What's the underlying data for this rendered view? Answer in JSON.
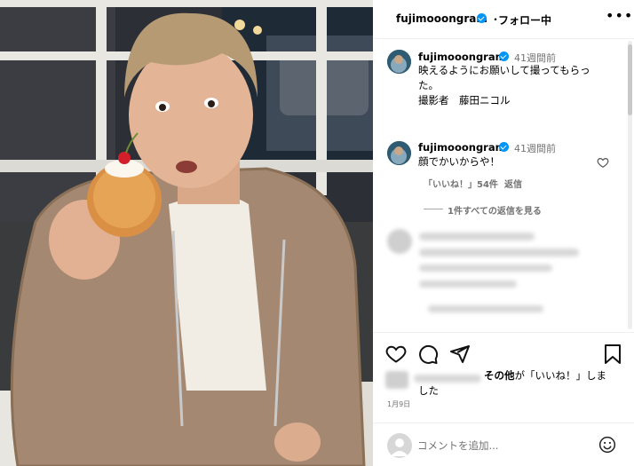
{
  "header": {
    "username": "fujimooongram",
    "dot": "・",
    "follow_status": "フォロー中",
    "more": "•••"
  },
  "comments": [
    {
      "username": "fujimooongram",
      "time": "41週間前",
      "text_line1": "映えるようにお願いして撮ってもらっ",
      "text_line2": "た。",
      "text_line3": "撮影者　藤田ニコル"
    },
    {
      "username": "fujimooongram",
      "time": "41週間前",
      "text": "顔でかいからや！",
      "likes": "「いいね！」54件",
      "reply": "返信",
      "view_replies": "1件すべての返信を見る"
    }
  ],
  "likes_line1_bold": "その他",
  "likes_line1": "が「いいね！」しま",
  "likes_line2": "した",
  "date": "1月9日",
  "comment_placeholder": "コメントを追加...",
  "icons": [
    "heart-icon",
    "comment-icon",
    "share-icon",
    "bookmark-icon",
    "emoji-icon",
    "more-icon",
    "verified-icon"
  ],
  "colors": {
    "accent": "#0095f6",
    "muted": "#737373"
  }
}
